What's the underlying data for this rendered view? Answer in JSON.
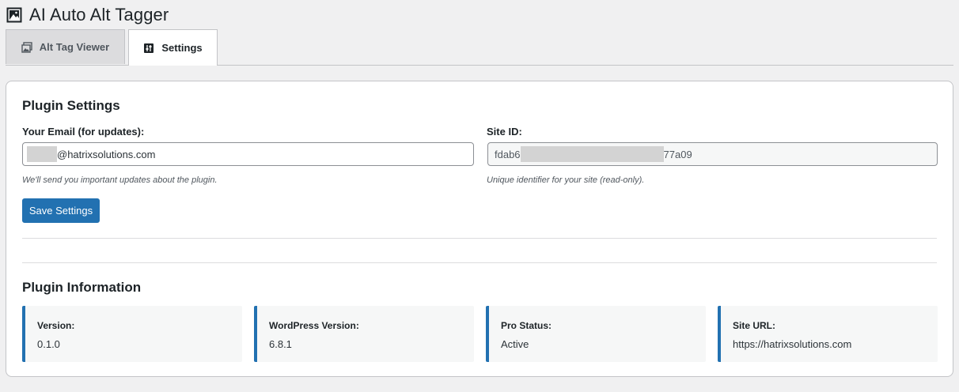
{
  "header": {
    "title": "AI Auto Alt Tagger",
    "icon": "image-icon"
  },
  "tabs": [
    {
      "label": "Alt Tag Viewer",
      "icon": "images-icon",
      "active": false
    },
    {
      "label": "Settings",
      "icon": "settings-icon",
      "active": true
    }
  ],
  "settings": {
    "title": "Plugin Settings",
    "email": {
      "label": "Your Email (for updates):",
      "value_visible": "@hatrixsolutions.com",
      "hint": "We'll send you important updates about the plugin."
    },
    "site_id": {
      "label": "Site ID:",
      "value_prefix": "fdab6",
      "value_suffix": "77a09",
      "hint": "Unique identifier for your site (read-only)."
    },
    "save_button": "Save Settings"
  },
  "info": {
    "title": "Plugin Information",
    "items": [
      {
        "label": "Version:",
        "value": "0.1.0"
      },
      {
        "label": "WordPress Version:",
        "value": "6.8.1"
      },
      {
        "label": "Pro Status:",
        "value": "Active"
      },
      {
        "label": "Site URL:",
        "value": "https://hatrixsolutions.com"
      }
    ]
  },
  "colors": {
    "accent": "#2271b1",
    "background": "#f0f0f1",
    "card": "#ffffff"
  }
}
